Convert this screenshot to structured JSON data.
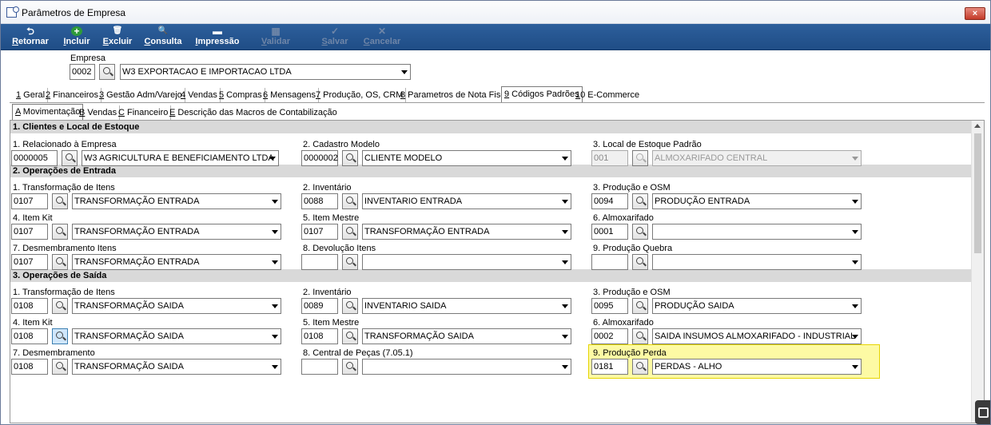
{
  "window": {
    "title": "Parâmetros de Empresa",
    "close": "×"
  },
  "toolbar": {
    "items": [
      {
        "hot": "R",
        "rest": "etornar",
        "icon": "⮌"
      },
      {
        "hot": "I",
        "rest": "ncluir",
        "icon": "+"
      },
      {
        "hot": "E",
        "rest": "xcluir",
        "icon": "🗑"
      },
      {
        "hot": "C",
        "rest": "onsulta",
        "icon": "🔍"
      },
      {
        "hot": "I",
        "rest": "mpressão",
        "icon": "▬"
      },
      {
        "hot": "V",
        "rest": "alidar",
        "icon": "▦"
      },
      {
        "hot": "S",
        "rest": "alvar",
        "icon": "✓"
      },
      {
        "hot": "C",
        "rest": "ancelar",
        "icon": "✕"
      }
    ]
  },
  "empresa": {
    "label": "Empresa",
    "code": "0002",
    "name": "W3 EXPORTACAO E IMPORTACAO LTDA"
  },
  "main_tabs": [
    {
      "hot": "1",
      "rest": " Geral"
    },
    {
      "hot": "2",
      "rest": " Financeiros"
    },
    {
      "hot": "3",
      "rest": " Gestão Adm/Varejo"
    },
    {
      "hot": "4",
      "rest": " Vendas"
    },
    {
      "hot": "5",
      "rest": " Compras"
    },
    {
      "hot": "6",
      "rest": " Mensagens"
    },
    {
      "hot": "7",
      "rest": " Produção, OS, CRM"
    },
    {
      "hot": "8",
      "rest": " Parametros de Nota Fiscal"
    },
    {
      "hot": "9",
      "rest": " Códigos Padrões"
    },
    {
      "hot": "1",
      "rest": "0 E-Commerce"
    }
  ],
  "sub_tabs": [
    {
      "hot": "A",
      "rest": " Movimentação"
    },
    {
      "hot": "B",
      "rest": " Vendas"
    },
    {
      "hot": "C",
      "rest": " Financeiro"
    },
    {
      "hot": "E",
      "rest": " Descrição das Macros de Contabilização"
    }
  ],
  "sections": [
    {
      "title": "1.  Clientes e Local de Estoque",
      "rows": [
        [
          {
            "label": "1. Relacionado à Empresa",
            "code": "0000005",
            "value": "W3 AGRICULTURA E BENEFICIAMENTO LTDA"
          },
          {
            "label": "2. Cadastro Modelo",
            "code": "0000002",
            "value": "CLIENTE MODELO"
          },
          {
            "label": "3. Local de Estoque Padrão",
            "code": "001",
            "value": "ALMOXARIFADO CENTRAL"
          }
        ]
      ]
    },
    {
      "title": "2.  Operações de Entrada",
      "rows": [
        [
          {
            "label": "1. Transformação de Itens",
            "code": "0107",
            "value": "TRANSFORMAÇÃO ENTRADA"
          },
          {
            "label": "2. Inventário",
            "code": "0088",
            "value": "INVENTARIO ENTRADA"
          },
          {
            "label": "3. Produção e OSM",
            "code": "0094",
            "value": "PRODUÇÃO ENTRADA"
          }
        ],
        [
          {
            "label": "4. Item Kit",
            "code": "0107",
            "value": "TRANSFORMAÇÃO ENTRADA"
          },
          {
            "label": "5. Item Mestre",
            "code": "0107",
            "value": "TRANSFORMAÇÃO ENTRADA"
          },
          {
            "label": "6. Almoxarifado",
            "code": "0001",
            "value": ""
          }
        ],
        [
          {
            "label": "7. Desmembramento Itens",
            "code": "0107",
            "value": "TRANSFORMAÇÃO ENTRADA"
          },
          {
            "label": "8. Devolução Itens",
            "code": "",
            "value": ""
          },
          {
            "label": "9. Produção Quebra",
            "code": "",
            "value": ""
          }
        ]
      ]
    },
    {
      "title": "3.  Operações de Saída",
      "rows": [
        [
          {
            "label": "1. Transformação de Itens",
            "code": "0108",
            "value": "TRANSFORMAÇÃO SAIDA"
          },
          {
            "label": "2. Inventário",
            "code": "0089",
            "value": "INVENTARIO SAIDA"
          },
          {
            "label": "3. Produção e OSM",
            "code": "0095",
            "value": "PRODUÇÃO SAIDA"
          }
        ],
        [
          {
            "label": "4. Item Kit",
            "code": "0108",
            "value": "TRANSFORMAÇÃO SAIDA"
          },
          {
            "label": "5. Item Mestre",
            "code": "0108",
            "value": "TRANSFORMAÇÃO SAIDA"
          },
          {
            "label": "6. Almoxarifado",
            "code": "0002",
            "value": "SAIDA INSUMOS ALMOXARIFADO - INDUSTRIAL"
          }
        ],
        [
          {
            "label": "7. Desmembramento",
            "code": "0108",
            "value": "TRANSFORMAÇÃO SAIDA"
          },
          {
            "label": "8. Central de Peças (7.05.1)",
            "code": "",
            "value": ""
          },
          {
            "label": "9. Produção Perda",
            "code": "0181",
            "value": "PERDAS - ALHO"
          }
        ]
      ]
    }
  ]
}
